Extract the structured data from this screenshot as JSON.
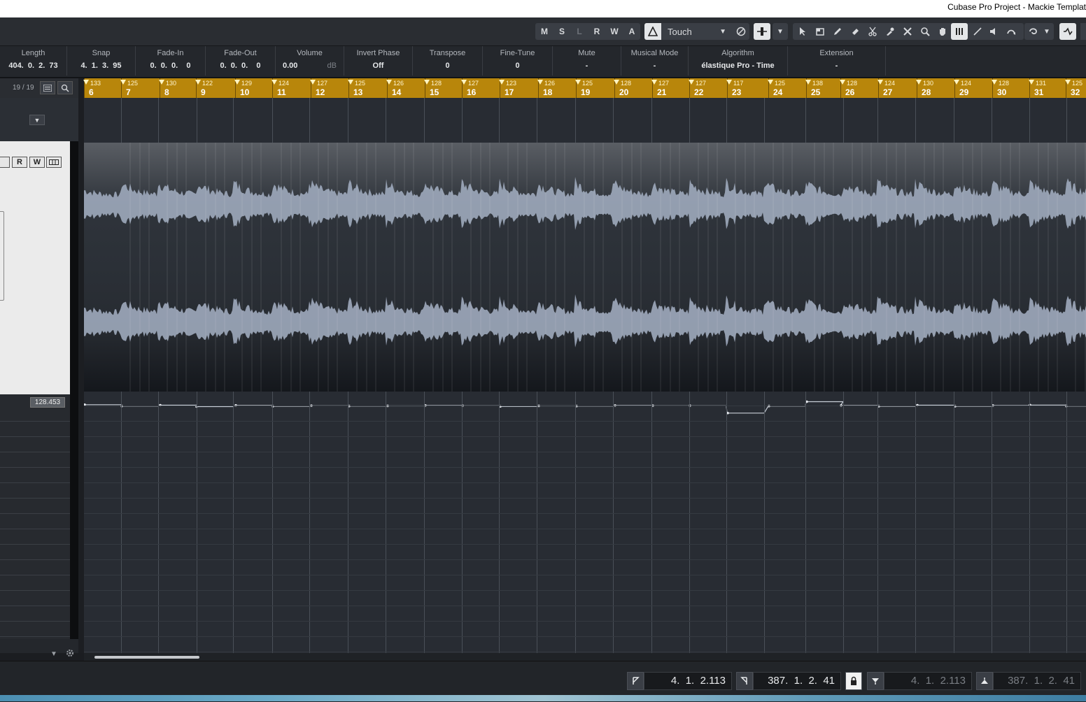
{
  "window": {
    "title": "Cubase Pro Project - Mackie Templat"
  },
  "toolbar": {
    "buttons": [
      "M",
      "S",
      "L",
      "R",
      "W",
      "A"
    ],
    "automation_mode": "Touch"
  },
  "infoline": {
    "fields": [
      {
        "label": "Length",
        "value": "404.  0.  2.  73"
      },
      {
        "label": "Snap",
        "value": "4.  1.  3.  95"
      },
      {
        "label": "Fade-In",
        "value": "0.  0.  0.    0"
      },
      {
        "label": "Fade-Out",
        "value": "0.  0.  0.    0"
      },
      {
        "label": "Volume",
        "value": "0.00",
        "unit": "dB"
      },
      {
        "label": "Invert Phase",
        "value": "Off"
      },
      {
        "label": "Transpose",
        "value": "0"
      },
      {
        "label": "Fine-Tune",
        "value": "0"
      },
      {
        "label": "Mute",
        "value": "-"
      },
      {
        "label": "Musical Mode",
        "value": "-"
      },
      {
        "label": "Algorithm",
        "value": "élastique Pro - Time"
      },
      {
        "label": "Extension",
        "value": "-"
      }
    ]
  },
  "left_panel": {
    "counter": "19 / 19",
    "tempo_value": "128.453",
    "track_buttons": [
      "R",
      "W"
    ]
  },
  "ruler": {
    "bars": [
      "6",
      "7",
      "8",
      "9",
      "10",
      "11",
      "12",
      "13",
      "14",
      "15",
      "16",
      "17",
      "18",
      "19",
      "20",
      "21",
      "22",
      "23",
      "24",
      "25",
      "26",
      "27",
      "28",
      "29",
      "30",
      "31",
      "32"
    ],
    "tempos": [
      "133",
      "125",
      "130",
      "122",
      "129",
      "124",
      "127",
      "125",
      "126",
      "128",
      "127",
      "123",
      "126",
      "125",
      "128",
      "127",
      "127",
      "117",
      "125",
      "138",
      "128",
      "124",
      "130",
      "124",
      "128",
      "131",
      "125"
    ]
  },
  "transport": {
    "left_locator": "4.  1.  2.113",
    "right_locator": "387.  1.  2.  41",
    "punch_in": "4.  1.  2.113",
    "punch_out": "387.  1.  2.  41"
  }
}
